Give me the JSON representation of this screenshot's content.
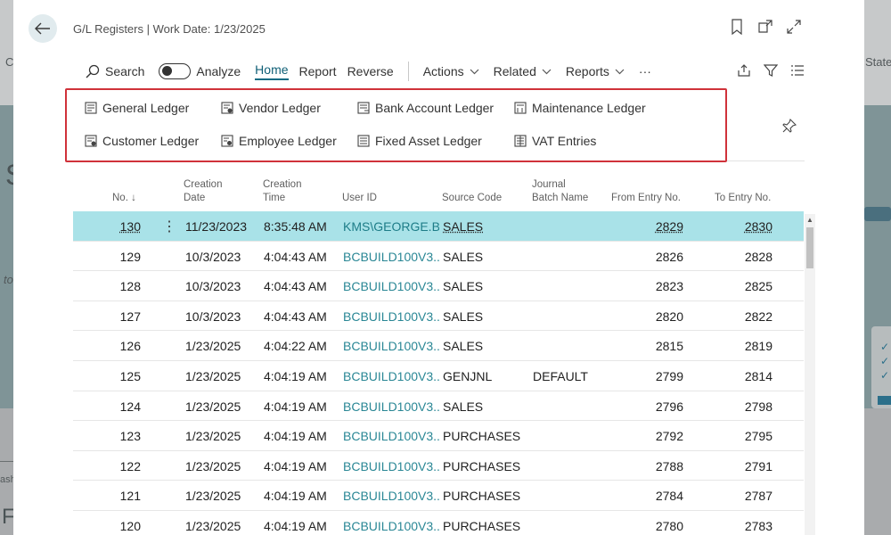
{
  "background": {
    "right_text": "State",
    "left_letter": "S",
    "left_italic": "to",
    "bottom_label": "ash",
    "bottom_letter": "F"
  },
  "header": {
    "title": "G/L Registers | Work Date: 1/23/2025"
  },
  "actions": {
    "search": "Search",
    "analyze": "Analyze",
    "home": "Home",
    "report": "Report",
    "reverse": "Reverse",
    "actions": "Actions",
    "related": "Related",
    "reports": "Reports",
    "more": "···"
  },
  "ledgers": {
    "general": "General Ledger",
    "vendor": "Vendor Ledger",
    "bank": "Bank Account Ledger",
    "maintenance": "Maintenance Ledger",
    "customer": "Customer Ledger",
    "employee": "Employee Ledger",
    "fixed_asset": "Fixed Asset Ledger",
    "vat": "VAT Entries"
  },
  "table": {
    "headers": {
      "no": "No. ↓",
      "creation_date_1": "Creation",
      "creation_date_2": "Date",
      "creation_time_1": "Creation",
      "creation_time_2": "Time",
      "user_id": "User ID",
      "source_code": "Source Code",
      "journal_batch_1": "Journal",
      "journal_batch_2": "Batch Name",
      "from_entry": "From Entry No.",
      "to_entry": "To Entry No."
    },
    "rows": [
      {
        "no": "130",
        "date": "11/23/2023",
        "time": "8:35:48 AM",
        "user": "KMS\\GEORGE.B...",
        "source": "SALES",
        "batch": "",
        "from": "2829",
        "to": "2830"
      },
      {
        "no": "129",
        "date": "10/3/2023",
        "time": "4:04:43 AM",
        "user": "BCBUILD100V3...",
        "source": "SALES",
        "batch": "",
        "from": "2826",
        "to": "2828"
      },
      {
        "no": "128",
        "date": "10/3/2023",
        "time": "4:04:43 AM",
        "user": "BCBUILD100V3...",
        "source": "SALES",
        "batch": "",
        "from": "2823",
        "to": "2825"
      },
      {
        "no": "127",
        "date": "10/3/2023",
        "time": "4:04:43 AM",
        "user": "BCBUILD100V3...",
        "source": "SALES",
        "batch": "",
        "from": "2820",
        "to": "2822"
      },
      {
        "no": "126",
        "date": "1/23/2025",
        "time": "4:04:22 AM",
        "user": "BCBUILD100V3...",
        "source": "SALES",
        "batch": "",
        "from": "2815",
        "to": "2819"
      },
      {
        "no": "125",
        "date": "1/23/2025",
        "time": "4:04:19 AM",
        "user": "BCBUILD100V3...",
        "source": "GENJNL",
        "batch": "DEFAULT",
        "from": "2799",
        "to": "2814"
      },
      {
        "no": "124",
        "date": "1/23/2025",
        "time": "4:04:19 AM",
        "user": "BCBUILD100V3...",
        "source": "SALES",
        "batch": "",
        "from": "2796",
        "to": "2798"
      },
      {
        "no": "123",
        "date": "1/23/2025",
        "time": "4:04:19 AM",
        "user": "BCBUILD100V3...",
        "source": "PURCHASES",
        "batch": "",
        "from": "2792",
        "to": "2795"
      },
      {
        "no": "122",
        "date": "1/23/2025",
        "time": "4:04:19 AM",
        "user": "BCBUILD100V3...",
        "source": "PURCHASES",
        "batch": "",
        "from": "2788",
        "to": "2791"
      },
      {
        "no": "121",
        "date": "1/23/2025",
        "time": "4:04:19 AM",
        "user": "BCBUILD100V3...",
        "source": "PURCHASES",
        "batch": "",
        "from": "2784",
        "to": "2787"
      },
      {
        "no": "120",
        "date": "1/23/2025",
        "time": "4:04:19 AM",
        "user": "BCBUILD100V3...",
        "source": "PURCHASES",
        "batch": "",
        "from": "2780",
        "to": "2783"
      }
    ]
  },
  "colors": {
    "accent": "#0f6b83",
    "selected_row": "#a9e2e8",
    "highlight_border": "#d0323a",
    "link": "#2a8795"
  }
}
